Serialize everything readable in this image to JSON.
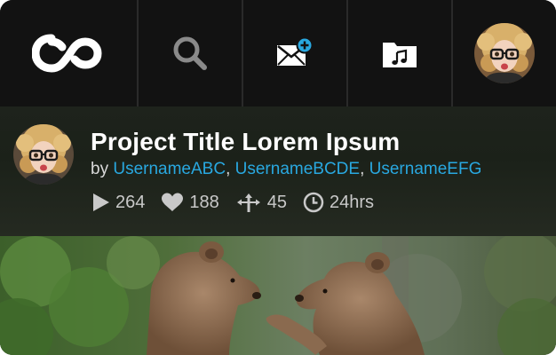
{
  "nav": {
    "items": [
      {
        "name": "logo",
        "icon": "infinity-logo-icon"
      },
      {
        "name": "search",
        "icon": "search-icon"
      },
      {
        "name": "messages",
        "icon": "mail-add-icon"
      },
      {
        "name": "music",
        "icon": "music-folder-icon"
      },
      {
        "name": "profile",
        "icon": "avatar"
      }
    ]
  },
  "project": {
    "title": "Project Title Lorem Ipsum",
    "by_prefix": "by",
    "users": [
      "UsernameABC",
      "UsernameBCDE",
      "UsernameEFG"
    ],
    "separator": ",",
    "stats": {
      "plays": "264",
      "likes": "188",
      "remixes": "45",
      "age": "24hrs"
    }
  },
  "colors": {
    "accent": "#29a8e0",
    "nav_bg": "#121212",
    "panel_bg": "#1e231c"
  }
}
